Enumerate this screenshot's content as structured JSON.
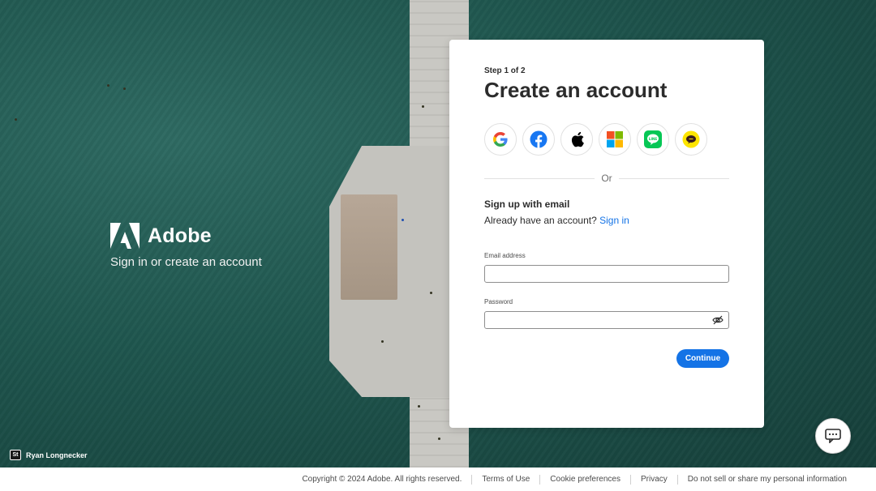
{
  "brand": {
    "name": "Adobe",
    "tagline": "Sign in or create an account"
  },
  "photo_credit": {
    "badge": "St",
    "name": "Ryan Longnecker"
  },
  "card": {
    "step": "Step 1 of 2",
    "title": "Create an account",
    "social_providers": [
      {
        "name": "google-icon"
      },
      {
        "name": "facebook-icon"
      },
      {
        "name": "apple-icon"
      },
      {
        "name": "microsoft-icon"
      },
      {
        "name": "line-icon"
      },
      {
        "name": "kakaotalk-icon"
      }
    ],
    "divider_text": "Or",
    "signup_heading": "Sign up with email",
    "already_text": "Already have an account?",
    "sign_in_link": "Sign in",
    "email": {
      "label": "Email address",
      "value": ""
    },
    "password": {
      "label": "Password",
      "value": ""
    },
    "continue_label": "Continue"
  },
  "footer": {
    "copyright": "Copyright © 2024 Adobe. All rights reserved.",
    "links": [
      "Terms of Use",
      "Cookie preferences",
      "Privacy",
      "Do not sell or share my personal information"
    ]
  },
  "colors": {
    "accent": "#1473e6",
    "water": "#1f564e"
  }
}
